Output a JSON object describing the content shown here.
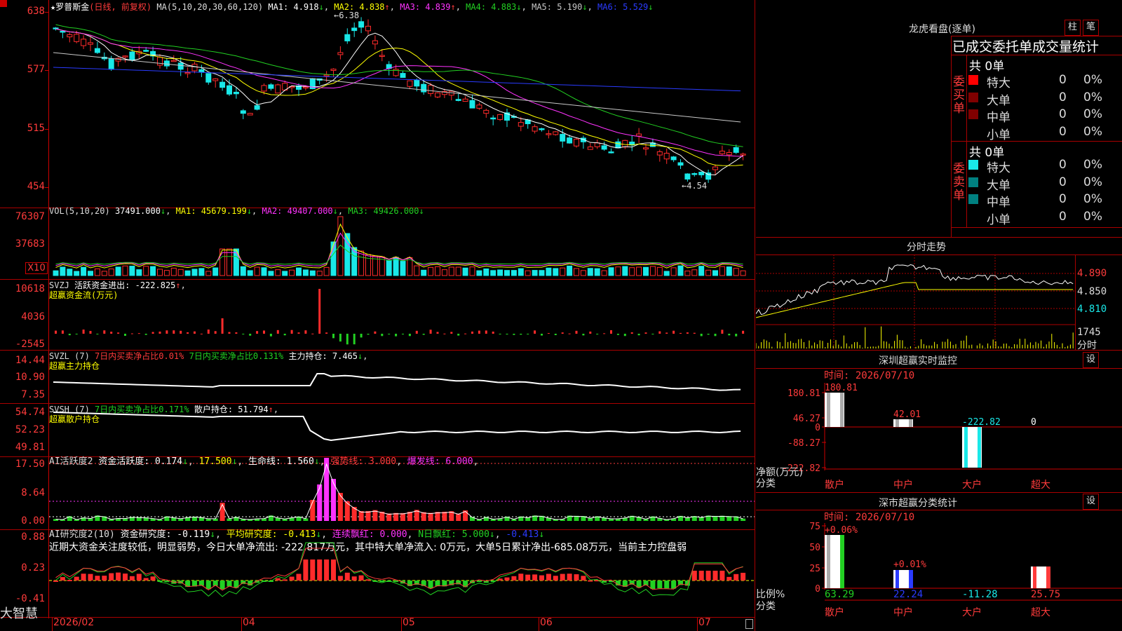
{
  "colors": {
    "up": "#ff2b2b",
    "down": "#19e8e8",
    "ma1": "#ffffff",
    "ma2": "#ffff00",
    "ma3": "#ff33ff",
    "ma4": "#22d022",
    "ma5": "#c8c8c8",
    "ma6": "#2a3bff"
  },
  "app": {
    "brand": "大智慧"
  },
  "main": {
    "stock_name": "罗普斯金",
    "mode": "(日线, 前复权)",
    "ma_params": "MA(5,10,20,30,60,120)",
    "ma1": "MA1: 4.918",
    "ma2": "MA2: 4.838",
    "ma3": "MA3: 4.839",
    "ma4": "MA4: 4.883",
    "ma5": "MA5: 5.190",
    "ma6": "MA6: 5.529",
    "high_mark": "6.38",
    "low_mark": "4.54",
    "y_labels": [
      "638",
      "577",
      "515",
      "454"
    ]
  },
  "vol": {
    "title": "VOL(5,10,20)",
    "value": "37491.000",
    "ma1": "MA1: 45679.199",
    "ma2": "MA2: 49407.000",
    "ma3": "MA3: 49426.000",
    "y_labels": [
      "76307",
      "37683"
    ],
    "unit": "X10"
  },
  "svzj": {
    "title": "SVZJ",
    "desc": "活跃资金进出: -222.825",
    "sub": "超赢资金流(万元)",
    "y_labels": [
      "10618",
      "4036",
      "-2545"
    ]
  },
  "svzl": {
    "title": "SVZL (7)",
    "buy": "7日内买卖净占比0.01%",
    "buy2": "7日内买卖净占比0.131%",
    "hold": "主力持仓: 7.465",
    "sub": "超赢主力持仓",
    "y_labels": [
      "14.44",
      "10.90",
      "7.35"
    ]
  },
  "svsh": {
    "title": "SVSH (7)",
    "buy": "7日内买卖净占比0.171%",
    "hold": "散户持仓: 51.794",
    "sub": "超赢散户持仓",
    "y_labels": [
      "54.74",
      "52.23",
      "49.81"
    ]
  },
  "ai1": {
    "title": "AI活跃度2",
    "v1": "资金活跃度: 0.174",
    "v2": "17.500",
    "v3": "生命线: 1.560",
    "v4": "强势线: 3.000",
    "v5": "爆发线: 6.000",
    "y_labels": [
      "17.50",
      "8.64",
      "0.00"
    ]
  },
  "ai2": {
    "title": "AI研究度2(10)",
    "v1": "资金研究度: -0.119",
    "v2": "平均研究度: -0.413",
    "v3": "连续飘红: 0.000",
    "v4": "N日飘红: 5.000",
    "v5": "-0.413",
    "comment": "近期大资金关注度较低，明显弱势，今日大单净流出: -222.817万元，其中特大单净流入: 0万元，大单5日累计净出-685.08万元，当前主力控盘弱",
    "y_labels": [
      "0.88",
      "0.23",
      "-0.41"
    ]
  },
  "x_axis": [
    "2026/02",
    "04",
    "05",
    "06",
    "07"
  ],
  "right": {
    "lhb": {
      "title": "龙虎看盘(逐单)",
      "btn1": "柱",
      "btn2": "笔",
      "tabs": "已成交委托单成交量统计",
      "buy": {
        "side": "委买单",
        "total": "共 0单",
        "rows": [
          {
            "name": "特大",
            "n": "0",
            "p": "0%"
          },
          {
            "name": "大单",
            "n": "0",
            "p": "0%"
          },
          {
            "name": "中单",
            "n": "0",
            "p": "0%"
          },
          {
            "name": "小单",
            "n": "0",
            "p": "0%"
          }
        ]
      },
      "sell": {
        "side": "委卖单",
        "total": "共 0单",
        "rows": [
          {
            "name": "特大",
            "n": "0",
            "p": "0%"
          },
          {
            "name": "大单",
            "n": "0",
            "p": "0%"
          },
          {
            "name": "中单",
            "n": "0",
            "p": "0%"
          },
          {
            "name": "小单",
            "n": "0",
            "p": "0%"
          }
        ]
      }
    },
    "fenshi": {
      "title": "分时走势",
      "y_labels": [
        "4.890",
        "4.850",
        "4.810"
      ],
      "vol_label": "1745",
      "vol_unit": "分时"
    },
    "sz_monitor": {
      "title": "深圳超赢实时监控",
      "btn": "设",
      "time": "时间: 2026/07/10",
      "y_labels": [
        "180.81",
        "46.27",
        "0",
        "-88.27",
        "-222.82"
      ],
      "bars": [
        {
          "cat": "散户",
          "value": "180.81"
        },
        {
          "cat": "中户",
          "value": "42.01"
        },
        {
          "cat": "大户",
          "value": "-222.82"
        },
        {
          "cat": "超大",
          "value": "0"
        }
      ],
      "unit": "净额(万元)",
      "unit2": "分类"
    },
    "sz_class": {
      "title": "深市超赢分类统计",
      "btn": "设",
      "time": "时间: 2026/07/10",
      "y_labels": [
        "75",
        "50",
        "25",
        "0"
      ],
      "bars": [
        {
          "cat": "散户",
          "top": "+0.06%",
          "bottom": "63.29"
        },
        {
          "cat": "中户",
          "top": "+0.01%",
          "bottom": "22.24"
        },
        {
          "cat": "大户",
          "top": "",
          "bottom": "-11.28"
        },
        {
          "cat": "超大",
          "top": "",
          "bottom": "25.75"
        }
      ],
      "unit": "比例%",
      "unit2": "分类"
    }
  }
}
